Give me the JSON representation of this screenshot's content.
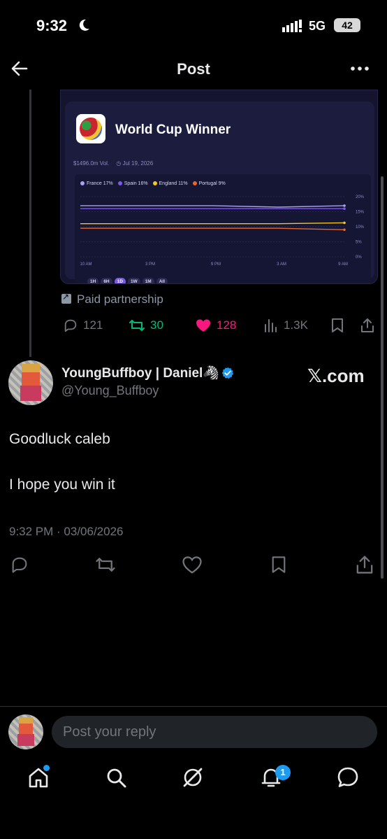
{
  "status_bar": {
    "time": "9:32",
    "network": "5G",
    "battery": "42"
  },
  "header": {
    "title": "Post"
  },
  "embed": {
    "card_title": "World Cup Winner",
    "volume": "$1496.0m Vol.",
    "date": "Jul 19, 2026",
    "legend": [
      {
        "name": "France 17%",
        "color": "#a9a2f2"
      },
      {
        "name": "Spain 16%",
        "color": "#7b5ae6"
      },
      {
        "name": "England 11%",
        "color": "#f3c623"
      },
      {
        "name": "Portugal 9%",
        "color": "#e8662e"
      }
    ],
    "ranges": [
      "1H",
      "6H",
      "1D",
      "1W",
      "1M",
      "All"
    ],
    "active_range": "1D",
    "paid_label": "Paid partnership",
    "stats": {
      "replies": "121",
      "reposts": "30",
      "likes": "128",
      "views": "1.3K"
    }
  },
  "chart_data": {
    "type": "line",
    "title": "World Cup Winner",
    "x": [
      "10 AM",
      "3 PM",
      "9 PM",
      "3 AM",
      "9 AM"
    ],
    "y_ticks": [
      "20%",
      "15%",
      "10%",
      "5%",
      "0%"
    ],
    "ylim": [
      0,
      20
    ],
    "series": [
      {
        "name": "France",
        "color": "#a9a2f2",
        "values": [
          17,
          17,
          17,
          16.5,
          17
        ]
      },
      {
        "name": "Spain",
        "color": "#7b5ae6",
        "values": [
          16,
          16,
          16,
          16,
          16
        ]
      },
      {
        "name": "England",
        "color": "#f3c623",
        "values": [
          11,
          11,
          11,
          11,
          11.3
        ]
      },
      {
        "name": "Portugal",
        "color": "#e8662e",
        "values": [
          9.5,
          9.5,
          9.5,
          9.5,
          9
        ]
      }
    ],
    "grid": true
  },
  "reply": {
    "name": "YoungBuffboy | Daniel🦓",
    "handle": "@Young_Buffboy",
    "badge_text": "𝕏.com",
    "text_line1": "Goodluck caleb",
    "text_line2": "I hope you win it",
    "timestamp": "9:32 PM · 03/06/2026"
  },
  "composer": {
    "placeholder": "Post your reply"
  },
  "nav": {
    "notifications_count": "1"
  }
}
